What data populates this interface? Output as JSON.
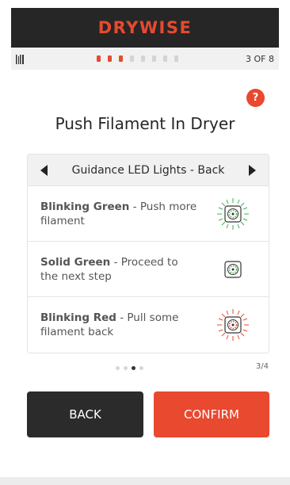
{
  "header": {
    "logo_text": "DRYWISE"
  },
  "progress": {
    "current_step": 3,
    "total_steps": 8,
    "step_label": "3 OF 8"
  },
  "help": {
    "label": "?"
  },
  "title": "Push Filament In Dryer",
  "card": {
    "heading": "Guidance LED Lights - Back",
    "items": [
      {
        "bold": "Blinking Green",
        "rest": " - Push more filament",
        "led_color": "#3ab54a",
        "icon": "dryer-blinking-green-icon"
      },
      {
        "bold": "Solid Green",
        "rest": " - Proceed to the next step",
        "led_color": "#3ab54a",
        "icon": "dryer-solid-green-icon"
      },
      {
        "bold": "Blinking Red",
        "rest": " - Pull some filament back",
        "led_color": "#e8492f",
        "icon": "dryer-blinking-red-icon"
      }
    ]
  },
  "pager": {
    "current": 3,
    "total": 4,
    "label": "3/4"
  },
  "buttons": {
    "back": "BACK",
    "confirm": "CONFIRM"
  },
  "colors": {
    "accent": "#e8492f",
    "dark": "#262626"
  }
}
